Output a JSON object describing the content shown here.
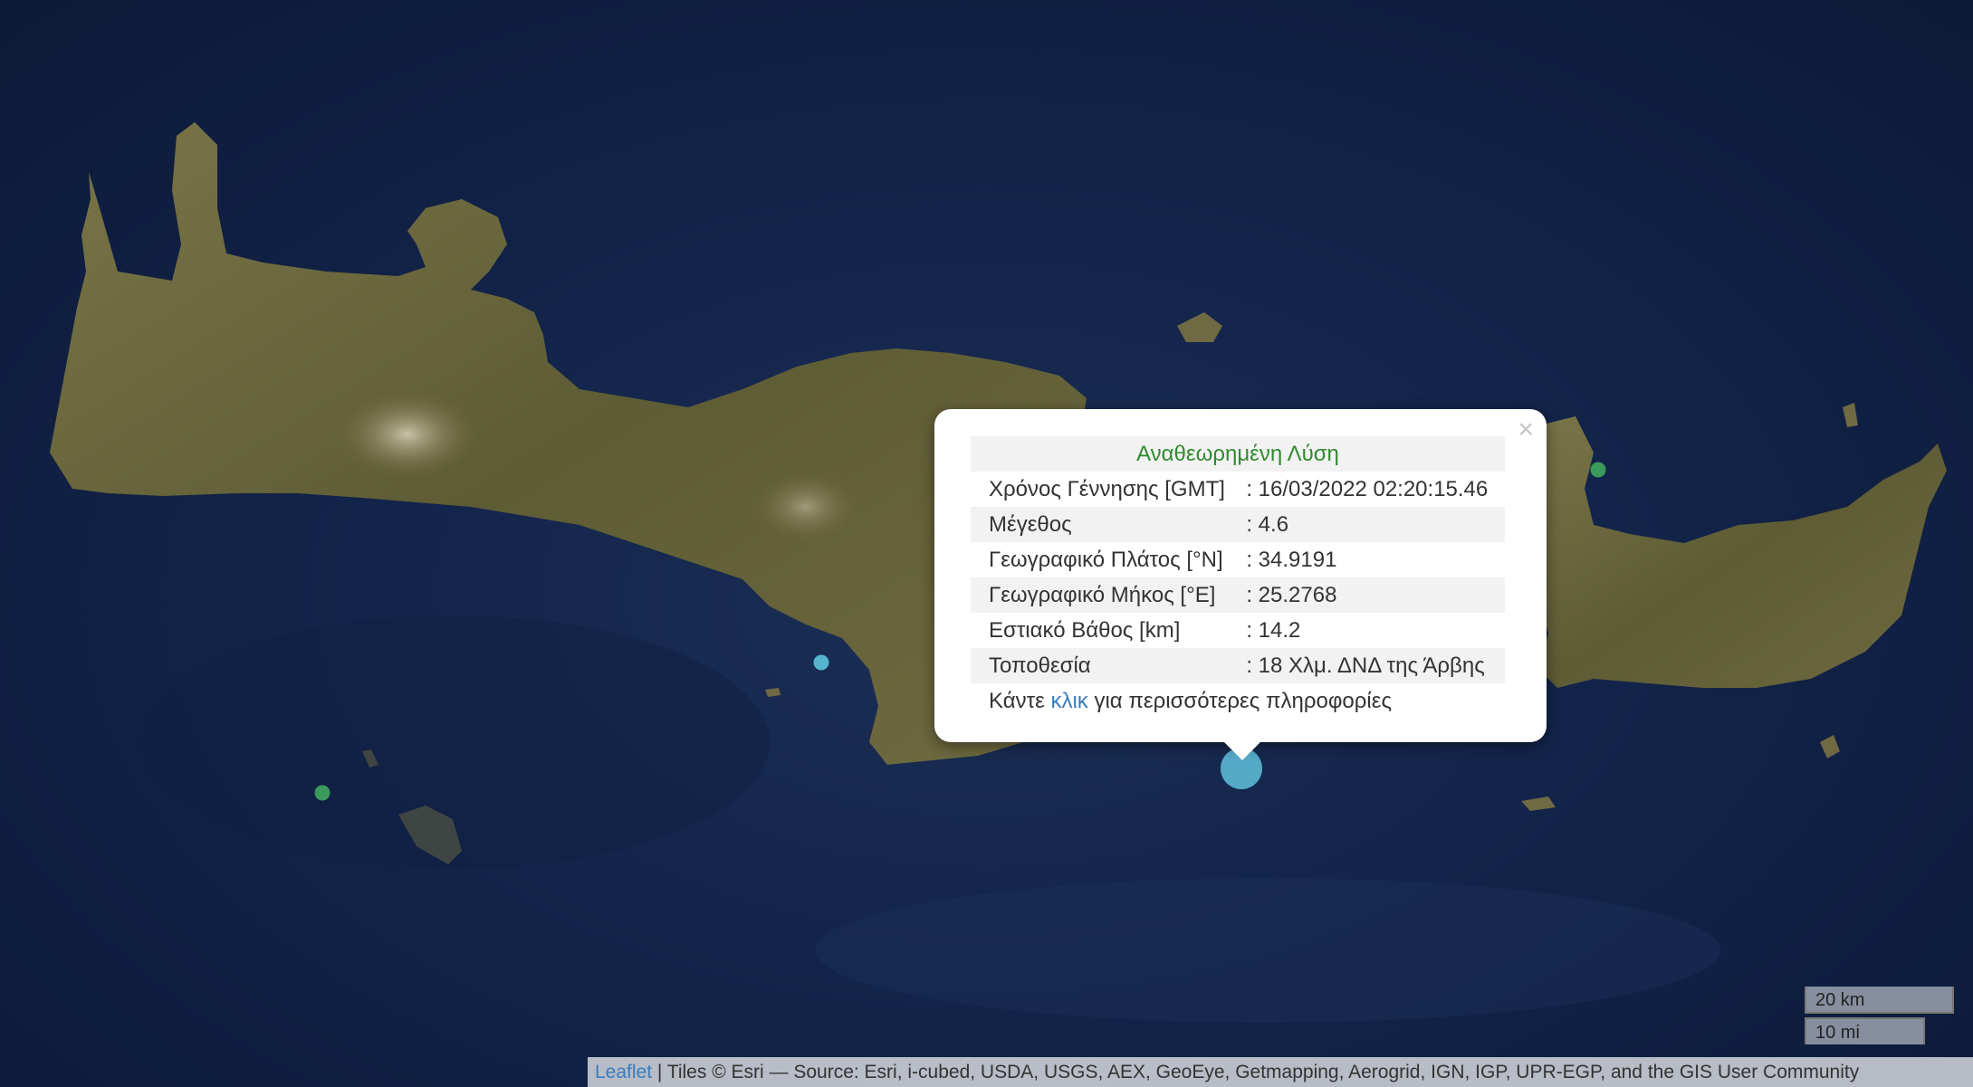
{
  "map": {
    "tile_style": "satellite imagery",
    "colors": {
      "sea": "#13244a",
      "land": "#6b6a3e",
      "marker_green": "#3fa75e",
      "marker_cyan": "#5bbcd6",
      "popup_title": "#2e8b2e",
      "link": "#3a7dbe"
    }
  },
  "popup": {
    "title": "Αναθεωρημένη Λύση",
    "close_icon": "×",
    "rows": [
      {
        "label": "Χρόνος Γέννησης [GMT]",
        "value": ": 16/03/2022 02:20:15.46"
      },
      {
        "label": "Μέγεθος",
        "value": ": 4.6"
      },
      {
        "label": "Γεωγραφικό Πλάτος [°N]",
        "value": ": 34.9191"
      },
      {
        "label": "Γεωγραφικό Μήκος [°E]",
        "value": ": 25.2768"
      },
      {
        "label": "Εστιακό Βάθος [km]",
        "value": ": 14.2"
      },
      {
        "label": "Τοποθεσία",
        "value": ": 18 Χλμ. ΔΝΔ της Άρβης"
      }
    ],
    "footer_before": "Κάντε ",
    "footer_link": "κλικ",
    "footer_after": " για περισσότερες πληροφορίες"
  },
  "scale": {
    "km_label": "20 km",
    "mi_label": "10 mi"
  },
  "attribution": {
    "leaflet_link": "Leaflet",
    "text": " | Tiles © Esri — Source: Esri, i-cubed, USDA, USGS, AEX, GeoEye, Getmapping, Aerogrid, IGN, IGP, UPR-EGP, and the GIS User Community"
  }
}
